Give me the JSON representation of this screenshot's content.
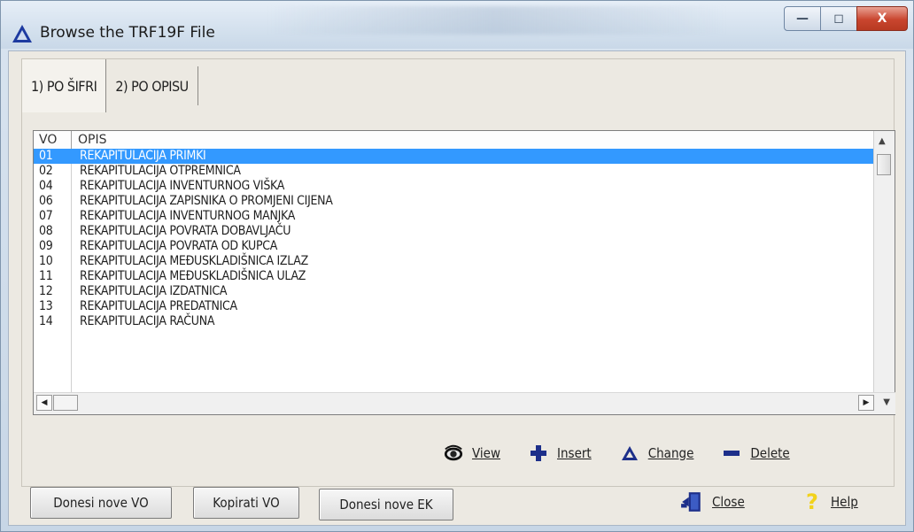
{
  "window": {
    "title": "Browse the TRF19F File",
    "minimize_label": "—",
    "maximize_label": "◻",
    "close_label": "X"
  },
  "tabs": [
    {
      "label": "1) PO ŠIFRI",
      "active": true
    },
    {
      "label": "2) PO OPISU",
      "active": false
    }
  ],
  "list": {
    "columns": [
      "VO",
      "OPIS"
    ],
    "rows": [
      {
        "vo": "01",
        "opis": "REKAPITULACIJA PRIMKI",
        "selected": true
      },
      {
        "vo": "02",
        "opis": "REKAPITULACIJA OTPREMNICA"
      },
      {
        "vo": "04",
        "opis": "REKAPITULACIJA INVENTURNOG VIŠKA"
      },
      {
        "vo": "06",
        "opis": "REKAPITULACIJA ZAPISNIKA O PROMJENI CIJENA"
      },
      {
        "vo": "07",
        "opis": "REKAPITULACIJA INVENTURNOG MANJKA"
      },
      {
        "vo": "08",
        "opis": "REKAPITULACIJA POVRATA DOBAVLJAČU"
      },
      {
        "vo": "09",
        "opis": "REKAPITULACIJA POVRATA OD KUPCA"
      },
      {
        "vo": "10",
        "opis": "REKAPITULACIJA MEĐUSKLADIŠNICA IZLAZ"
      },
      {
        "vo": "11",
        "opis": "REKAPITULACIJA MEĐUSKLADIŠNICA ULAZ"
      },
      {
        "vo": "12",
        "opis": "REKAPITULACIJA IZDATNICA"
      },
      {
        "vo": "13",
        "opis": "REKAPITULACIJA PREDATNICA"
      },
      {
        "vo": "14",
        "opis": "REKAPITULACIJA RAČUNA"
      }
    ]
  },
  "actions": {
    "view": "View",
    "insert": "Insert",
    "change": "Change",
    "delete": "Delete"
  },
  "bottom": {
    "donesi_vo": "Donesi nove VO",
    "kopirati_vo": "Kopirati VO",
    "donesi_ek": "Donesi nove EK",
    "close": "Close",
    "help": "Help"
  },
  "colors": {
    "selection": "#3399ff",
    "insert_icon": "#1d2f8a",
    "change_icon": "#1d2f8a",
    "delete_icon": "#1d2f8a",
    "help_icon": "#f2d21b"
  },
  "icons": {
    "app": "triangle-icon",
    "view": "eye-icon",
    "insert": "plus-icon",
    "change": "triangle-icon",
    "delete": "minus-icon",
    "close": "door-exit-icon",
    "help": "question-icon"
  }
}
